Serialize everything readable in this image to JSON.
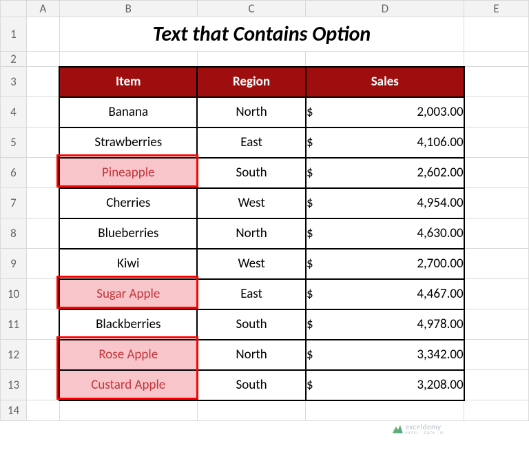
{
  "columns": {
    "A": "A",
    "B": "B",
    "C": "C",
    "D": "D",
    "E": "E"
  },
  "rows": [
    "1",
    "2",
    "3",
    "4",
    "5",
    "6",
    "7",
    "8",
    "9",
    "10",
    "11",
    "12",
    "13",
    "14"
  ],
  "title": "Text that Contains Option",
  "headers": {
    "item": "Item",
    "region": "Region",
    "sales": "Sales"
  },
  "currency": "$",
  "data": [
    {
      "item": "Banana",
      "region": "North",
      "sales": "2,003.00",
      "highlight": false
    },
    {
      "item": "Strawberries",
      "region": "East",
      "sales": "4,106.00",
      "highlight": false
    },
    {
      "item": "Pineapple",
      "region": "South",
      "sales": "2,602.00",
      "highlight": true
    },
    {
      "item": "Cherries",
      "region": "West",
      "sales": "4,954.00",
      "highlight": false
    },
    {
      "item": "Blueberries",
      "region": "North",
      "sales": "4,630.00",
      "highlight": false
    },
    {
      "item": "Kiwi",
      "region": "West",
      "sales": "2,700.00",
      "highlight": false
    },
    {
      "item": "Sugar Apple",
      "region": "East",
      "sales": "4,467.00",
      "highlight": true
    },
    {
      "item": "Blackberries",
      "region": "South",
      "sales": "4,978.00",
      "highlight": false
    },
    {
      "item": "Rose Apple",
      "region": "North",
      "sales": "3,342.00",
      "highlight": true
    },
    {
      "item": "Custard Apple",
      "region": "South",
      "sales": "3,208.00",
      "highlight": true
    }
  ],
  "watermark": {
    "brand": "exceldemy",
    "tagline": "EXCEL · DATA · BI"
  }
}
